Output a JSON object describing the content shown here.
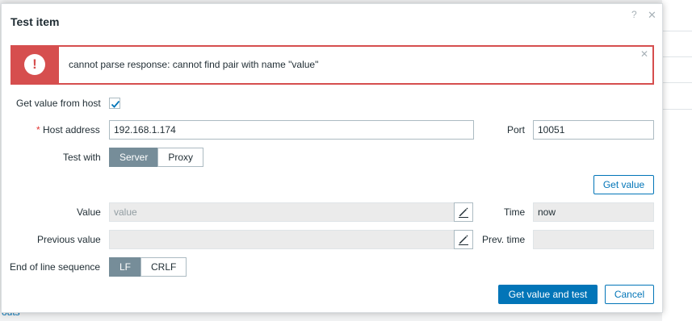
{
  "background": {
    "link_text": "outs"
  },
  "dialog": {
    "title": "Test item",
    "help_icon": "?",
    "close_icon": "✕"
  },
  "error": {
    "icon": "!",
    "message": "cannot parse response: cannot find pair with name \"value\"",
    "close_icon": "✕"
  },
  "form": {
    "get_value_from_host": {
      "label": "Get value from host",
      "checked": true
    },
    "host_address": {
      "required_mark": "*",
      "label": "Host address",
      "value": "192.168.1.174"
    },
    "port": {
      "label": "Port",
      "value": "10051"
    },
    "test_with": {
      "label": "Test with",
      "options": [
        "Server",
        "Proxy"
      ],
      "selected": "Server"
    },
    "get_value_button": "Get value",
    "value": {
      "label": "Value",
      "placeholder": "value"
    },
    "time": {
      "label": "Time",
      "value": "now"
    },
    "previous_value": {
      "label": "Previous value",
      "value": ""
    },
    "prev_time": {
      "label": "Prev. time",
      "value": ""
    },
    "eol": {
      "label": "End of line sequence",
      "options": [
        "LF",
        "CRLF"
      ],
      "selected": "LF"
    }
  },
  "footer": {
    "primary_button": "Get value and test",
    "cancel_button": "Cancel"
  },
  "colors": {
    "accent": "#0275b8",
    "error": "#d64e4e",
    "segment_active": "#768d99"
  }
}
